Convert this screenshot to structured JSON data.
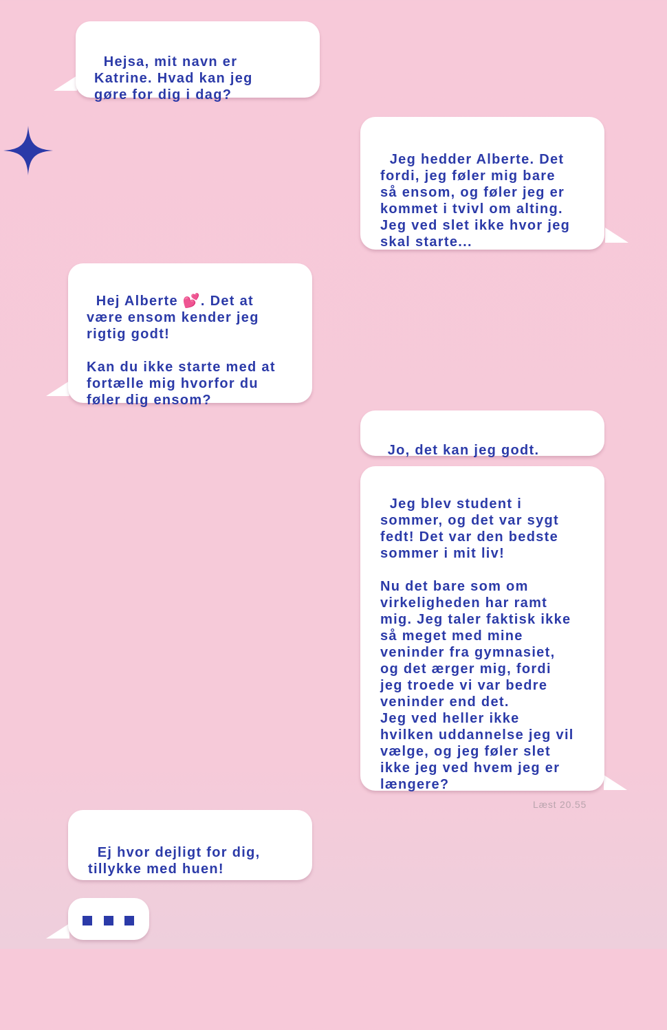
{
  "colors": {
    "background": "#f7c9d9",
    "bubble": "#ffffff",
    "text": "#2b3aa8",
    "star": "#2b3aa8",
    "read_receipt": "#b9a4ad"
  },
  "decor": {
    "star_icon": "four-point-star-icon"
  },
  "messages": [
    {
      "sender": "Katrine",
      "side": "left",
      "text": "Hejsa, mit navn er\nKatrine. Hvad kan jeg\ngøre for dig i dag?"
    },
    {
      "sender": "Alberte",
      "side": "right",
      "text": "Jeg hedder Alberte. Det\nfordi, jeg føler mig bare\nså ensom, og føler jeg er\nkommet i tvivl om alting.\nJeg ved slet ikke hvor jeg\nskal starte..."
    },
    {
      "sender": "Katrine",
      "side": "left",
      "text": "Hej Alberte 💕. Det at\nvære ensom kender jeg\nrigtig godt!\n\nKan du ikke starte med at\nfortælle mig hvorfor du\nføler dig ensom?"
    },
    {
      "sender": "Alberte",
      "side": "right",
      "text": "Jo, det kan jeg godt."
    },
    {
      "sender": "Alberte",
      "side": "right",
      "text": "Jeg blev student i\nsommer, og det var sygt\nfedt! Det var den bedste\nsommer i mit liv!\n\nNu det bare som om\nvirkeligheden har ramt\nmig. Jeg taler faktisk ikke\nså meget med mine\nveninder fra gymnasiet,\nog det ærger mig, fordi\njeg troede vi var bedre\nveninder end det.\nJeg ved heller ikke\nhvilken uddannelse jeg vil\nvælge, og jeg føler slet\nikke jeg ved hvem jeg er\nlængere?"
    },
    {
      "sender": "Katrine",
      "side": "left",
      "text": "Ej hvor dejligt for dig,\ntillykke med huen!"
    }
  ],
  "read_receipt": "Læst 20.55",
  "typing_indicator": {
    "icon": "typing-dots-icon",
    "dot_count": 3
  }
}
